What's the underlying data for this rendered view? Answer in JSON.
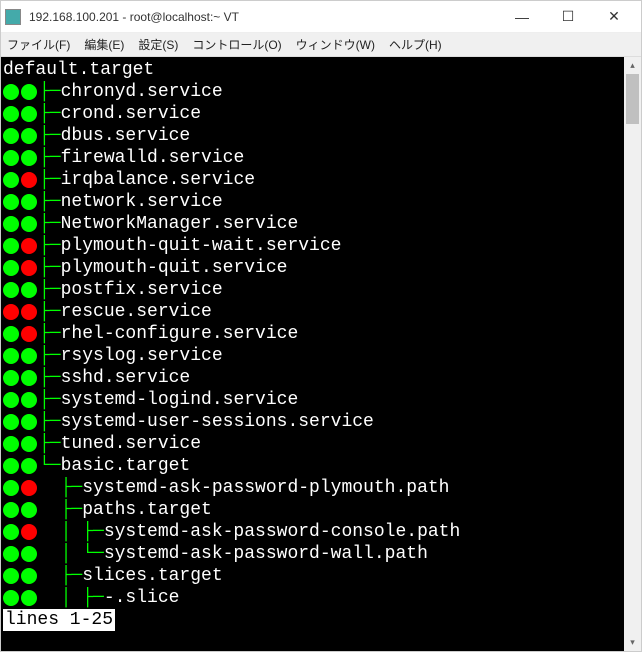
{
  "window": {
    "title": "192.168.100.201 - root@localhost:~ VT"
  },
  "menu": {
    "file": "ファイル(F)",
    "edit": "編集(E)",
    "setup": "設定(S)",
    "control": "コントロール(O)",
    "window": "ウィンドウ(W)",
    "help": "ヘルプ(H)"
  },
  "tree": {
    "root": "default.target",
    "items": [
      {
        "prefix": "├",
        "name": "chronyd.service",
        "dots": [
          "green",
          "green"
        ]
      },
      {
        "prefix": "├",
        "name": "crond.service",
        "dots": [
          "green",
          "green"
        ]
      },
      {
        "prefix": "├",
        "name": "dbus.service",
        "dots": [
          "green",
          "green"
        ]
      },
      {
        "prefix": "├",
        "name": "firewalld.service",
        "dots": [
          "green",
          "green"
        ]
      },
      {
        "prefix": "├",
        "name": "irqbalance.service",
        "dots": [
          "green",
          "red"
        ]
      },
      {
        "prefix": "├",
        "name": "network.service",
        "dots": [
          "green",
          "green"
        ]
      },
      {
        "prefix": "├",
        "name": "NetworkManager.service",
        "dots": [
          "green",
          "green"
        ]
      },
      {
        "prefix": "├",
        "name": "plymouth-quit-wait.service",
        "dots": [
          "green",
          "red"
        ]
      },
      {
        "prefix": "├",
        "name": "plymouth-quit.service",
        "dots": [
          "green",
          "red"
        ]
      },
      {
        "prefix": "├",
        "name": "postfix.service",
        "dots": [
          "green",
          "green"
        ]
      },
      {
        "prefix": "├",
        "name": "rescue.service",
        "dots": [
          "red",
          "red"
        ]
      },
      {
        "prefix": "├",
        "name": "rhel-configure.service",
        "dots": [
          "green",
          "red"
        ]
      },
      {
        "prefix": "├",
        "name": "rsyslog.service",
        "dots": [
          "green",
          "green"
        ]
      },
      {
        "prefix": "├",
        "name": "sshd.service",
        "dots": [
          "green",
          "green"
        ]
      },
      {
        "prefix": "├",
        "name": "systemd-logind.service",
        "dots": [
          "green",
          "green"
        ]
      },
      {
        "prefix": "├",
        "name": "systemd-user-sessions.service",
        "dots": [
          "green",
          "green"
        ]
      },
      {
        "prefix": "├",
        "name": "tuned.service",
        "dots": [
          "green",
          "green"
        ]
      },
      {
        "prefix": "└",
        "name": "basic.target",
        "dots": [
          "green",
          "green"
        ]
      }
    ],
    "sub1": [
      {
        "prefix": "  ├",
        "name": "systemd-ask-password-plymouth.path",
        "dots": [
          "green",
          "red"
        ]
      },
      {
        "prefix": "  ├",
        "name": "paths.target",
        "dots": [
          "green",
          "green"
        ]
      }
    ],
    "sub2": [
      {
        "prefix": "  │ ├",
        "name": "systemd-ask-password-console.path",
        "dots": [
          "green",
          "red"
        ]
      },
      {
        "prefix": "  │ └",
        "name": "systemd-ask-password-wall.path",
        "dots": [
          "green",
          "green"
        ]
      }
    ],
    "sub3": [
      {
        "prefix": "  ├",
        "name": "slices.target",
        "dots": [
          "green",
          "green"
        ]
      }
    ],
    "sub4": [
      {
        "prefix": "  │ ├",
        "name": "-.slice",
        "dots": [
          "green",
          "green"
        ]
      }
    ]
  },
  "status_line": "lines 1-25"
}
